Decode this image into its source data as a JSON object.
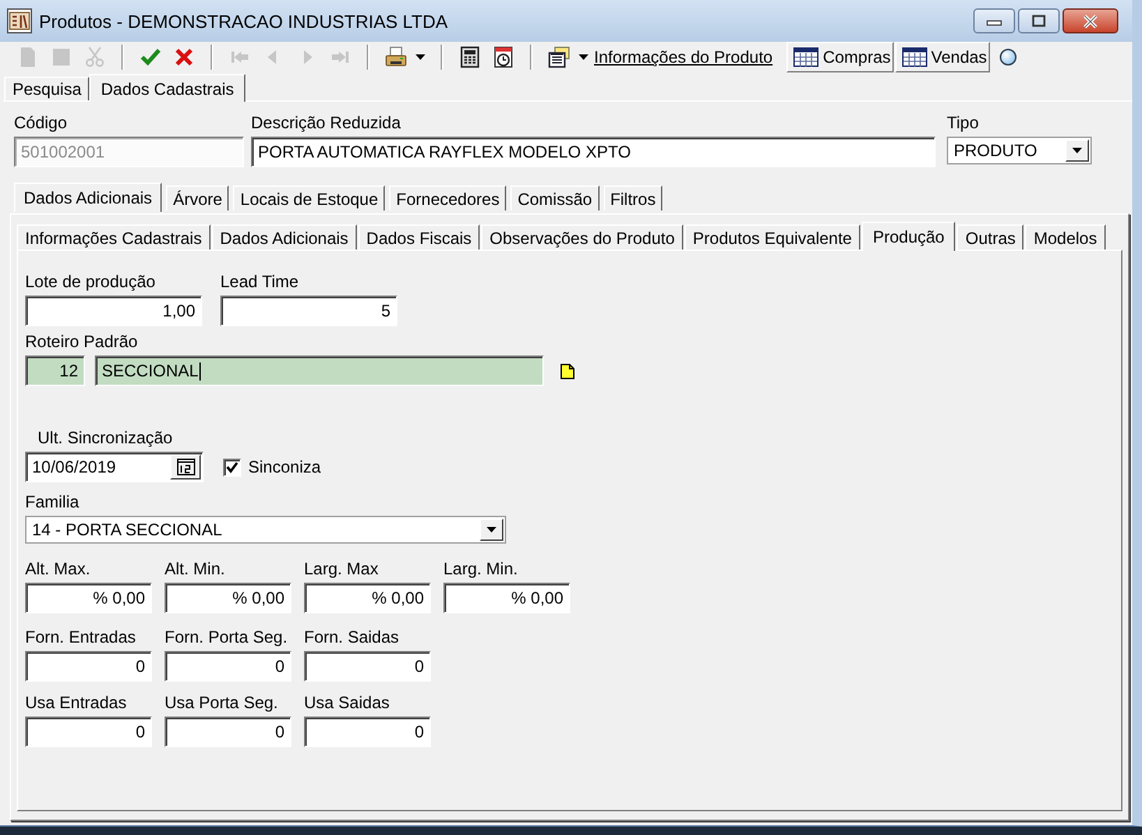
{
  "window": {
    "title": "Produtos - DEMONSTRACAO INDUSTRIAS LTDA"
  },
  "toolbar": {
    "buttons": [
      {
        "disabled": true
      },
      {
        "disabled": true
      },
      {
        "disabled": true
      },
      {
        "disabled": false
      },
      {
        "disabled": false
      },
      {
        "disabled": true
      },
      {
        "disabled": true
      },
      {
        "disabled": true
      },
      {
        "disabled": true
      },
      {
        "disabled": false
      },
      {
        "disabled": false
      },
      {
        "disabled": false
      },
      {
        "disabled": false
      }
    ],
    "link": "Informações do Produto",
    "grid_buttons": [
      "Compras",
      "Vendas"
    ]
  },
  "tabs": [
    {
      "label": "Pesquisa",
      "selected": false
    },
    {
      "label": "Dados Cadastrais",
      "selected": true
    }
  ],
  "header_fields": [
    {
      "kind": "text",
      "label": "Código",
      "value": "501002001",
      "disabled": true
    },
    {
      "kind": "text",
      "label": "Descrição Reduzida",
      "value": "PORTA AUTOMATICA RAYFLEX MODELO XPTO",
      "disabled": false
    },
    {
      "kind": "select",
      "label": "Tipo",
      "value": "PRODUTO"
    }
  ],
  "section_tabs": [
    {
      "label": "Dados Adicionais",
      "selected": true
    },
    {
      "label": "Árvore",
      "selected": false
    },
    {
      "label": "Locais de Estoque",
      "selected": false
    },
    {
      "label": "Fornecedores",
      "selected": false
    },
    {
      "label": "Comissão",
      "selected": false
    },
    {
      "label": "Filtros",
      "selected": false
    }
  ],
  "sub_tabs": [
    {
      "label": "Informações Cadastrais",
      "selected": false
    },
    {
      "label": "Dados Adicionais",
      "selected": false
    },
    {
      "label": "Dados Fiscais",
      "selected": false
    },
    {
      "label": "Observações do Produto",
      "selected": false
    },
    {
      "label": "Produtos Equivalente",
      "selected": false
    },
    {
      "label": "Produção",
      "selected": true
    },
    {
      "label": "Outras",
      "selected": false
    },
    {
      "label": "Modelos",
      "selected": false
    }
  ],
  "form": {
    "rows": [
      [
        {
          "kind": "number",
          "label": "Lote de produção",
          "value": "1,00"
        },
        {
          "kind": "number",
          "label": "Lead Time",
          "value": "5"
        }
      ],
      [
        {
          "kind": "lookup",
          "label": "Roteiro Padrão",
          "code": "12",
          "value": "SECCIONAL",
          "focused": true
        }
      ],
      [
        {
          "kind": "date",
          "label": "Ult. Sincronização",
          "value": "10/06/2019"
        },
        {
          "kind": "checkbox",
          "label": "Sinconiza",
          "checked": true
        }
      ],
      [
        {
          "kind": "select",
          "label": "Familia",
          "value": "14 - PORTA SECCIONAL"
        }
      ],
      [
        {
          "kind": "number",
          "label": "Alt. Max.",
          "value": "% 0,00"
        },
        {
          "kind": "number",
          "label": "Alt. Min.",
          "value": "% 0,00"
        },
        {
          "kind": "number",
          "label": "Larg. Max",
          "value": "% 0,00"
        },
        {
          "kind": "number",
          "label": "Larg. Min.",
          "value": "% 0,00"
        }
      ],
      [
        {
          "kind": "number",
          "label": "Forn. Entradas",
          "value": "0"
        },
        {
          "kind": "number",
          "label": "Forn. Porta Seg.",
          "value": "0"
        },
        {
          "kind": "number",
          "label": "Forn. Saidas",
          "value": "0"
        }
      ],
      [
        {
          "kind": "number",
          "label": "Usa Entradas",
          "value": "0"
        },
        {
          "kind": "number",
          "label": "Usa Porta Seg.",
          "value": "0"
        },
        {
          "kind": "number",
          "label": "Usa Saidas",
          "value": "0"
        }
      ]
    ]
  }
}
